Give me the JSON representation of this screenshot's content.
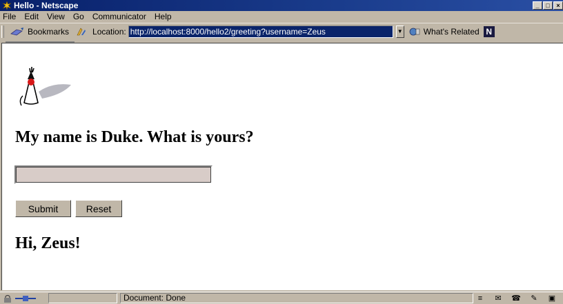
{
  "window": {
    "title": "Hello - Netscape"
  },
  "menu": {
    "items": [
      "File",
      "Edit",
      "View",
      "Go",
      "Communicator",
      "Help"
    ]
  },
  "toolbar": {
    "bookmarks_label": "Bookmarks",
    "location_label": "Location:",
    "url": "http://localhost:8000/hello2/greeting?username=Zeus",
    "related_label": "What's Related"
  },
  "page": {
    "heading": "My name is Duke. What is yours?",
    "input_value": "",
    "submit_label": "Submit",
    "reset_label": "Reset",
    "greeting": "Hi, Zeus!"
  },
  "status": {
    "text": "Document: Done"
  },
  "icons": {
    "app": "netscape-star-icon",
    "bookmarks": "bookmarks-icon",
    "location": "location-icon",
    "related": "whats-related-icon",
    "duke": "duke-mascot-image"
  },
  "colors": {
    "titlebar": "#0a246a",
    "chrome": "#c0b7a8",
    "url_highlight": "#0a246a"
  }
}
